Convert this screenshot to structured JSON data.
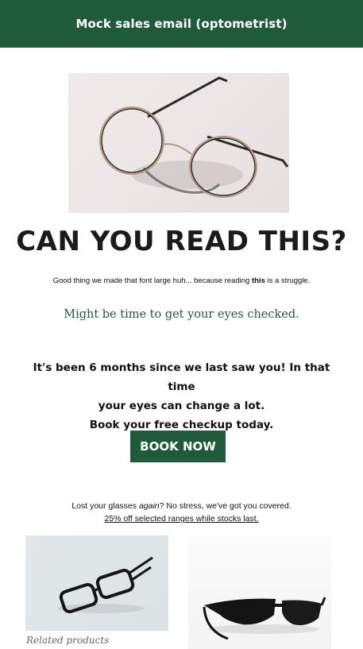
{
  "header": {
    "title": "Mock sales email (optometrist)"
  },
  "hero": {
    "image_icon": "eyeglasses-photo",
    "headline": "CAN YOU READ THIS?",
    "subline_pre": "Good thing we made that font large huh... because reading ",
    "subline_bold": "this",
    "subline_post": " is a struggle.",
    "tagline": "Might be time to get your eyes checked."
  },
  "body": {
    "line1": "It's been 6 months since we last saw you! In that time",
    "line2": "your eyes can change a lot.",
    "line3": "Book your free checkup today.",
    "cta_label": "BOOK NOW"
  },
  "promo": {
    "line_pre": "Lost your glasses ",
    "line_italic": "again",
    "line_post": "? No stress, we've got you covered.",
    "link_text": "25% off selected ranges while stocks last."
  },
  "products": {
    "items": [
      {
        "icon": "black-frame-glasses-photo"
      },
      {
        "icon": "sunglasses-photo"
      }
    ],
    "label": "Related products"
  },
  "colors": {
    "brand_green": "#1f5a3b",
    "background": "#ffffff"
  }
}
